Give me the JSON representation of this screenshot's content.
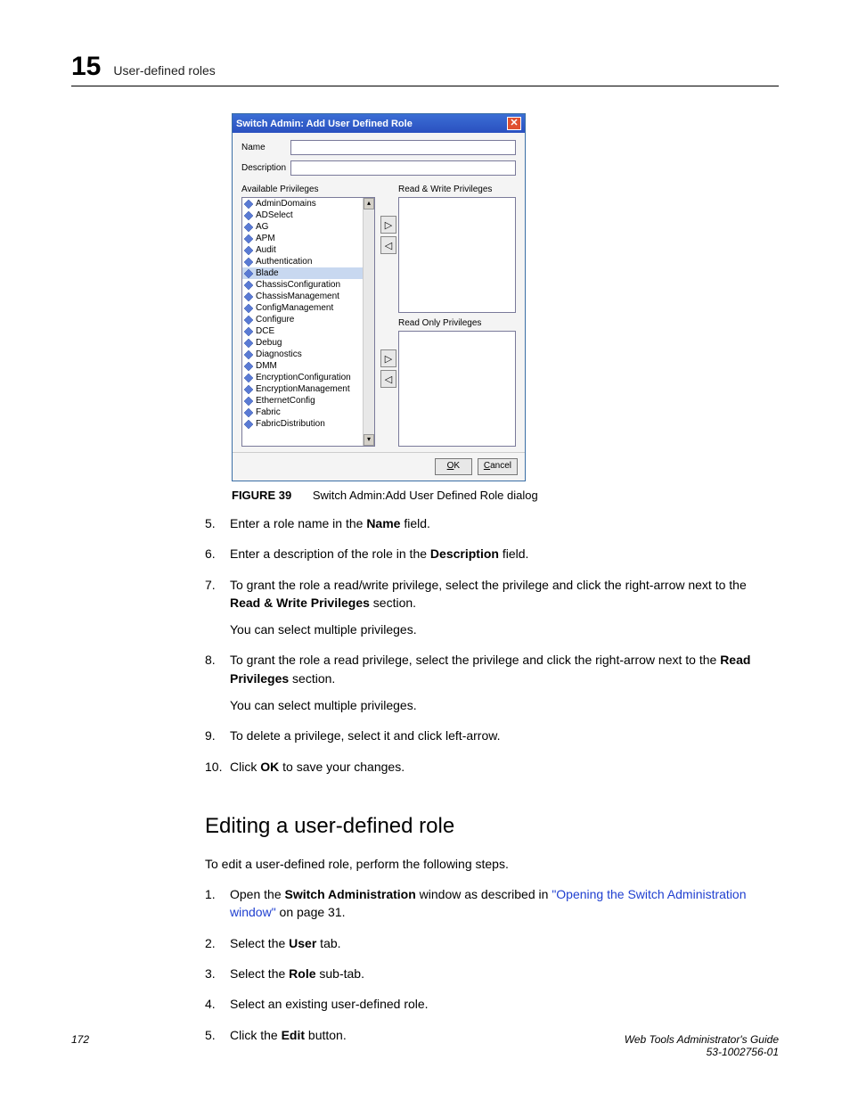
{
  "header": {
    "chapter": "15",
    "title": "User-defined roles"
  },
  "dialog": {
    "title": "Switch Admin: Add User Defined Role",
    "close_x": "✕",
    "name_label": "Name",
    "desc_label": "Description",
    "avail_label": "Available Privileges",
    "rw_label": "Read & Write Privileges",
    "ro_label": "Read Only Privileges",
    "privileges": [
      "AdminDomains",
      "ADSelect",
      "AG",
      "APM",
      "Audit",
      "Authentication",
      "Blade",
      "ChassisConfiguration",
      "ChassisManagement",
      "ConfigManagement",
      "Configure",
      "DCE",
      "Debug",
      "Diagnostics",
      "DMM",
      "EncryptionConfiguration",
      "EncryptionManagement",
      "EthernetConfig",
      "Fabric",
      "FabricDistribution"
    ],
    "selected_index": 6,
    "arrow_right": "▷",
    "arrow_left": "◁",
    "scroll_up": "▴",
    "scroll_down": "▾",
    "ok_label": "OK",
    "cancel_label": "Cancel"
  },
  "figure": {
    "label": "FIGURE 39",
    "caption": "Switch Admin:Add User Defined Role dialog"
  },
  "steps_a": [
    {
      "n": "5.",
      "pre": "Enter a role name in the ",
      "bold": "Name",
      "post": " field."
    },
    {
      "n": "6.",
      "pre": "Enter a description of the role in the ",
      "bold": "Description",
      "post": " field."
    }
  ],
  "step7": {
    "n": "7.",
    "text_a": "To grant the role a read/write privilege, select the privilege and click the right-arrow next to the ",
    "bold": "Read & Write Privileges",
    "text_b": " section.",
    "note": "You can select multiple privileges."
  },
  "step8": {
    "n": "8.",
    "text_a": "To grant the role a read privilege, select the privilege and click the right-arrow next to the ",
    "bold": "Read Privileges",
    "text_b": " section.",
    "note": "You can select multiple privileges."
  },
  "step9": {
    "n": "9.",
    "text": "To delete a privilege, select it and click left-arrow."
  },
  "step10": {
    "n": "10.",
    "pre": "Click ",
    "bold": "OK",
    "post": " to save your changes."
  },
  "h2": "Editing a user-defined role",
  "intro": "To edit a user-defined role, perform the following steps.",
  "edit_steps": {
    "s1": {
      "n": "1.",
      "pre": "Open the ",
      "bold": "Switch Administration",
      "mid": " window as described in ",
      "link": "\"Opening the Switch Administration window\"",
      "post": " on page 31."
    },
    "s2": {
      "n": "2.",
      "pre": "Select the ",
      "bold": "User",
      "post": " tab."
    },
    "s3": {
      "n": "3.",
      "pre": "Select the ",
      "bold": "Role",
      "post": " sub-tab."
    },
    "s4": {
      "n": "4.",
      "text": "Select an existing user-defined role."
    },
    "s5": {
      "n": "5.",
      "pre": "Click the ",
      "bold": "Edit",
      "post": " button."
    }
  },
  "footer": {
    "page": "172",
    "doc_title": "Web Tools Administrator's Guide",
    "doc_num": "53-1002756-01"
  }
}
